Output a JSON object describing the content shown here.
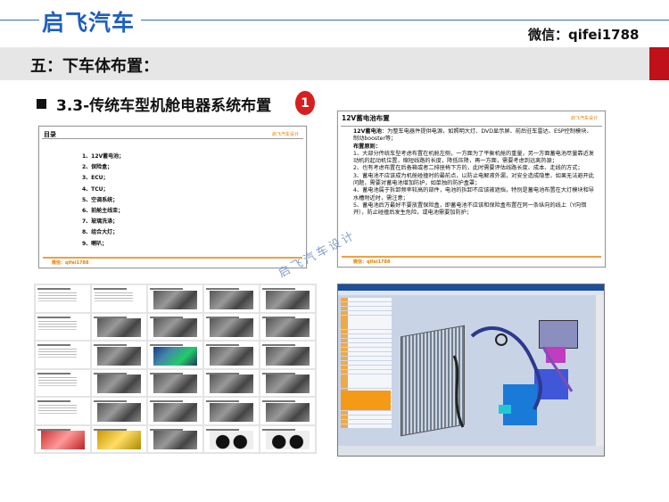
{
  "header": {
    "brand": "启飞汽车",
    "wechat": "微信：qifei1788"
  },
  "section_title": "五：下车体布置：",
  "subsection": {
    "title": "3.3-传统车型机舱电器系统布置",
    "badge": "1"
  },
  "slide_toc": {
    "heading": "目录",
    "brand_small": "启飞汽车设计",
    "items": [
      "1、12V蓄电池；",
      "2、保险盒；",
      "3、ECU；",
      "4、TCU；",
      "5、空调系统；",
      "6、前舱主线束；",
      "7、玻璃洗涤；",
      "8、组合大灯；",
      "9、喇叭；"
    ],
    "footer": "微信：qifei1788"
  },
  "slide_battery": {
    "heading": "12V蓄电池布置",
    "brand_small": "启飞汽车设计",
    "intro_key": "12V蓄电池",
    "intro_text": "：为整车电器件提供电源，如照明大灯、DVD显示屏、前后驻车雷达、ESP控制模块、制动booster等；",
    "principles_title": "布置原则：",
    "principles": [
      "1、大部分传统车型考虑布置在机舱左侧，一方面为了平衡机舱的重量，另一方面蓄电池尽量靠近发动机的起动机位置，缩短线路的长度，降低压降，再一方面，需要考虑到远离热源；",
      "2、也有考虑布置在后备箱或者二排座椅下方的，此时需要评估线路长度、成本、走线的方式；",
      "3、蓄电池不应该成为机舱碰撞时的最前点，以防止电解液外漏，对安全造成隐患，如果无法避开此问题，需要对蓄电池增加防护，如单独的防护盒罩；",
      "4、蓄电池属于拆卸频率较高的部件，电池的拆卸不应该被遮挡，特别是蓄电池布置在大灯模块和导水槽附近时，需注意；",
      "5、蓄电池后方最好不要放置保险盒，即蓄电池不应该和保险盒布置在同一条纵向的线上（Y向错开），防止碰撞后发生危险，或电池需要加防护；"
    ],
    "footer": "微信：qifei1788"
  },
  "watermark": "启飞汽车设计",
  "thumbnails": {
    "count": 30
  },
  "colors": {
    "brand_blue": "#1f5fbf",
    "accent_red": "#c0101a",
    "orange": "#e67e00"
  }
}
